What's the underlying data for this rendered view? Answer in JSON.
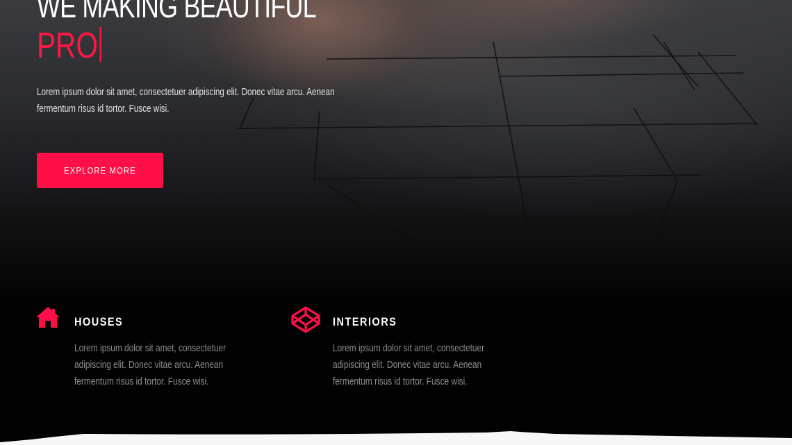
{
  "hero": {
    "title": "WE MAKING BEAUTIFUL",
    "typed_text": "PRO",
    "description": "Lorem ipsum dolor sit amet, consectetuer adipiscing elit. Donec vitae arcu. Aenean fermentum risus id tortor. Fusce wisi.",
    "cta_label": "EXPLORE MORE"
  },
  "features": [
    {
      "title": "HOUSES",
      "icon": "house-icon",
      "description": "Lorem ipsum dolor sit amet, consectetuer adipiscing elit. Donec vitae arcu. Aenean fermentum risus id tortor. Fusce wisi."
    },
    {
      "title": "INTERIORS",
      "icon": "codepen-cube-icon",
      "description": "Lorem ipsum dolor sit amet, consectetuer adipiscing elit. Donec vitae arcu. Aenean fermentum risus id tortor. Fusce wisi."
    }
  ],
  "colors": {
    "accent": "#ff0f47",
    "background": "#020203",
    "text": "#ffffff",
    "muted_text": "#8c8c8c"
  }
}
